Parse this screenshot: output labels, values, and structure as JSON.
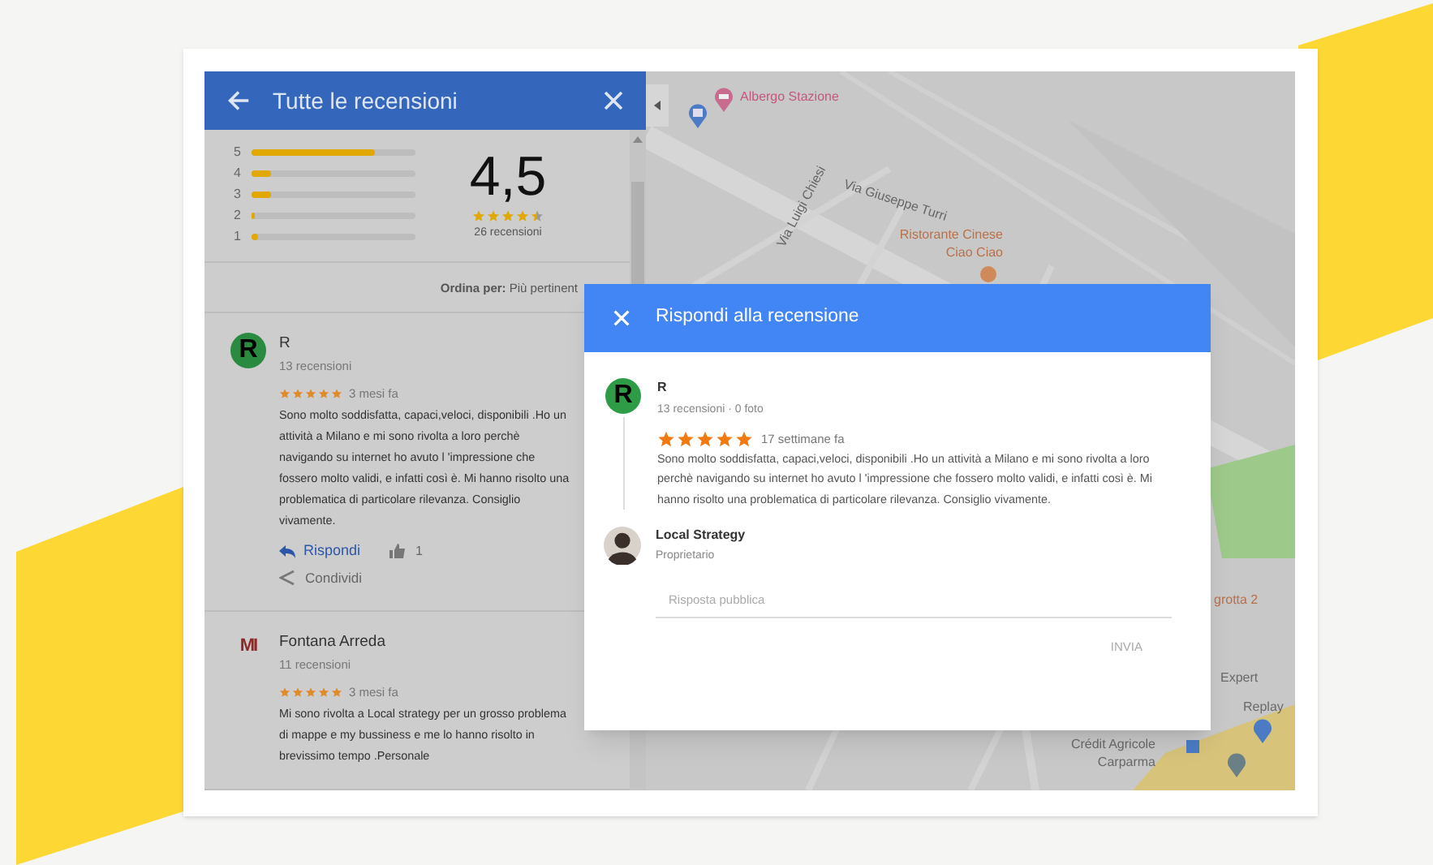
{
  "panel": {
    "title": "Tutte le recensioni",
    "histogram": [
      {
        "label": "5",
        "level": 0.75
      },
      {
        "label": "4",
        "level": 0.12
      },
      {
        "label": "3",
        "level": 0.12
      },
      {
        "label": "2",
        "level": 0.01
      },
      {
        "label": "1",
        "level": 0.04
      }
    ],
    "average": "4,5",
    "stars": 4.5,
    "count": "26 recensioni",
    "sort": "**Ordina per:** Più pertinent",
    "reviews": [
      {
        "avatar": {
          "kind": "initial",
          "text": "R"
        },
        "name": "R",
        "meta": "13 recensioni",
        "stars": 5,
        "time": "3 mesi fa",
        "text": "Sono molto soddisfatta, capaci,veloci, disponibili .Ho un attività a Milano e mi sono rivolta a loro perchè navigando su internet ho avuto l 'impressione che fossero molto validi, e infatti così è. Mi hanno risolto una problematica di particolare rilevanza. Consiglio vivamente.",
        "reply": "Rispondi",
        "likes": "1",
        "share": "Condividi"
      },
      {
        "avatar": {
          "kind": "logo",
          "text": "MI"
        },
        "name": "Fontana Arreda",
        "meta": "11 recensioni",
        "stars": 5,
        "time": "3 mesi fa",
        "text": "Mi sono rivolta a Local strategy per un grosso problema di mappe e my bussiness e me lo hanno risolto in brevissimo tempo .Personale"
      }
    ]
  },
  "map": {
    "labels": [
      {
        "kind": "lodging",
        "text": "Albergo Stazione"
      },
      {
        "kind": "street",
        "text": "Via Giuseppe Turri"
      },
      {
        "kind": "street",
        "text": "Via Luigi Chiesi"
      },
      {
        "kind": "food",
        "text": "Ristorante Cinese Ciao Ciao"
      },
      {
        "kind": "food",
        "text": "grotta 2"
      },
      {
        "kind": "business",
        "text": "Expert"
      },
      {
        "kind": "business",
        "text": "Replay"
      },
      {
        "kind": "business",
        "text": "Crédit Agricole Carparma"
      }
    ]
  },
  "dialog": {
    "title": "Rispondi alla recensione",
    "review": {
      "initial": "R",
      "name": "R",
      "meta": "13 recensioni · 0 foto",
      "stars": 5,
      "time": "17 settimane fa",
      "text": "Sono molto soddisfatta, capaci,veloci, disponibili .Ho un attività a Milano e mi sono rivolta a loro perchè navigando su internet ho avuto l 'impressione che fossero molto validi, e infatti così è. Mi hanno risolto una problematica di particolare rilevanza. Consiglio vivamente."
    },
    "owner": {
      "name": "Local Strategy",
      "role": "Proprietario"
    },
    "reply_field": {
      "placeholder": "Risposta pubblica"
    },
    "send": {
      "label": "INVIA",
      "disabled": true
    }
  }
}
